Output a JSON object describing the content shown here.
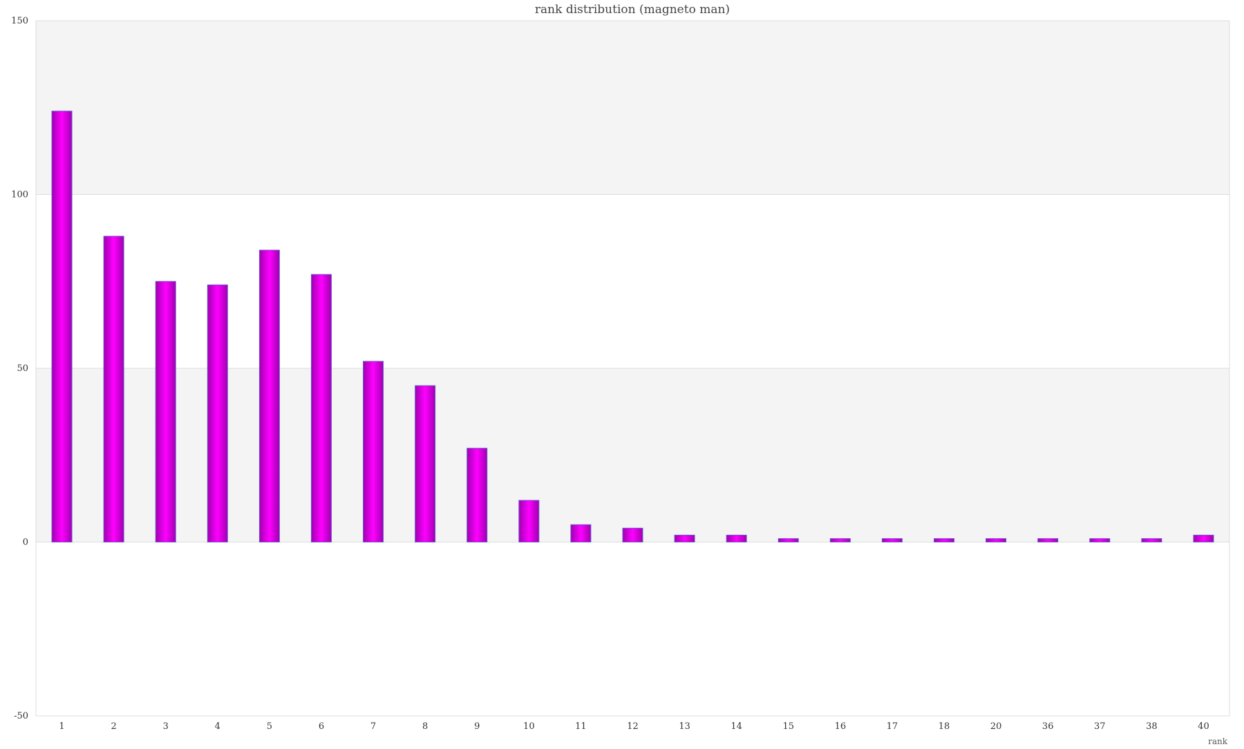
{
  "chart_data": {
    "type": "bar",
    "title": "rank distribution (magneto man)",
    "xlabel": "rank",
    "ylabel": "",
    "categories": [
      "1",
      "2",
      "3",
      "4",
      "5",
      "6",
      "7",
      "8",
      "9",
      "10",
      "11",
      "12",
      "13",
      "14",
      "15",
      "16",
      "17",
      "18",
      "20",
      "36",
      "37",
      "38",
      "40"
    ],
    "values": [
      124,
      88,
      75,
      74,
      84,
      77,
      52,
      45,
      27,
      12,
      5,
      4,
      2,
      2,
      1,
      1,
      1,
      1,
      1,
      1,
      1,
      1,
      2
    ],
    "ylim": [
      -50,
      150
    ],
    "yticks": [
      "150",
      "100",
      "50",
      "0",
      "-50"
    ],
    "grid": true,
    "legend": "none",
    "colors": {
      "bar_center": "#ff00ff",
      "bar_edge": "#a000b0",
      "bar_stroke": "#6a5acd",
      "band": "#f4f4f4",
      "grid": "#dddddd",
      "axis": "#cccccc"
    }
  }
}
